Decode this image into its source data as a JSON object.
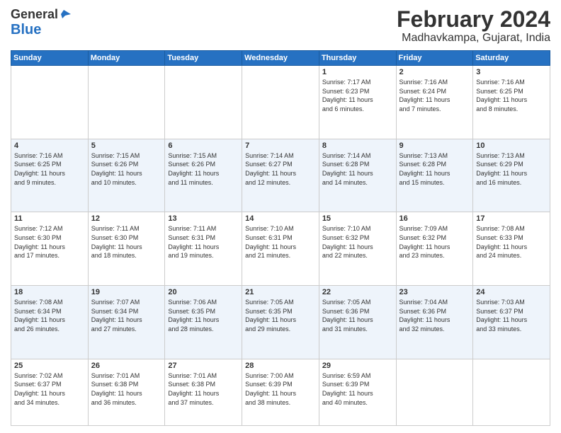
{
  "header": {
    "logo_line1": "General",
    "logo_line2": "Blue",
    "title": "February 2024",
    "subtitle": "Madhavkampa, Gujarat, India"
  },
  "days_of_week": [
    "Sunday",
    "Monday",
    "Tuesday",
    "Wednesday",
    "Thursday",
    "Friday",
    "Saturday"
  ],
  "weeks": [
    [
      {
        "day": "",
        "info": ""
      },
      {
        "day": "",
        "info": ""
      },
      {
        "day": "",
        "info": ""
      },
      {
        "day": "",
        "info": ""
      },
      {
        "day": "1",
        "info": "Sunrise: 7:17 AM\nSunset: 6:23 PM\nDaylight: 11 hours\nand 6 minutes."
      },
      {
        "day": "2",
        "info": "Sunrise: 7:16 AM\nSunset: 6:24 PM\nDaylight: 11 hours\nand 7 minutes."
      },
      {
        "day": "3",
        "info": "Sunrise: 7:16 AM\nSunset: 6:25 PM\nDaylight: 11 hours\nand 8 minutes."
      }
    ],
    [
      {
        "day": "4",
        "info": "Sunrise: 7:16 AM\nSunset: 6:25 PM\nDaylight: 11 hours\nand 9 minutes."
      },
      {
        "day": "5",
        "info": "Sunrise: 7:15 AM\nSunset: 6:26 PM\nDaylight: 11 hours\nand 10 minutes."
      },
      {
        "day": "6",
        "info": "Sunrise: 7:15 AM\nSunset: 6:26 PM\nDaylight: 11 hours\nand 11 minutes."
      },
      {
        "day": "7",
        "info": "Sunrise: 7:14 AM\nSunset: 6:27 PM\nDaylight: 11 hours\nand 12 minutes."
      },
      {
        "day": "8",
        "info": "Sunrise: 7:14 AM\nSunset: 6:28 PM\nDaylight: 11 hours\nand 14 minutes."
      },
      {
        "day": "9",
        "info": "Sunrise: 7:13 AM\nSunset: 6:28 PM\nDaylight: 11 hours\nand 15 minutes."
      },
      {
        "day": "10",
        "info": "Sunrise: 7:13 AM\nSunset: 6:29 PM\nDaylight: 11 hours\nand 16 minutes."
      }
    ],
    [
      {
        "day": "11",
        "info": "Sunrise: 7:12 AM\nSunset: 6:30 PM\nDaylight: 11 hours\nand 17 minutes."
      },
      {
        "day": "12",
        "info": "Sunrise: 7:11 AM\nSunset: 6:30 PM\nDaylight: 11 hours\nand 18 minutes."
      },
      {
        "day": "13",
        "info": "Sunrise: 7:11 AM\nSunset: 6:31 PM\nDaylight: 11 hours\nand 19 minutes."
      },
      {
        "day": "14",
        "info": "Sunrise: 7:10 AM\nSunset: 6:31 PM\nDaylight: 11 hours\nand 21 minutes."
      },
      {
        "day": "15",
        "info": "Sunrise: 7:10 AM\nSunset: 6:32 PM\nDaylight: 11 hours\nand 22 minutes."
      },
      {
        "day": "16",
        "info": "Sunrise: 7:09 AM\nSunset: 6:32 PM\nDaylight: 11 hours\nand 23 minutes."
      },
      {
        "day": "17",
        "info": "Sunrise: 7:08 AM\nSunset: 6:33 PM\nDaylight: 11 hours\nand 24 minutes."
      }
    ],
    [
      {
        "day": "18",
        "info": "Sunrise: 7:08 AM\nSunset: 6:34 PM\nDaylight: 11 hours\nand 26 minutes."
      },
      {
        "day": "19",
        "info": "Sunrise: 7:07 AM\nSunset: 6:34 PM\nDaylight: 11 hours\nand 27 minutes."
      },
      {
        "day": "20",
        "info": "Sunrise: 7:06 AM\nSunset: 6:35 PM\nDaylight: 11 hours\nand 28 minutes."
      },
      {
        "day": "21",
        "info": "Sunrise: 7:05 AM\nSunset: 6:35 PM\nDaylight: 11 hours\nand 29 minutes."
      },
      {
        "day": "22",
        "info": "Sunrise: 7:05 AM\nSunset: 6:36 PM\nDaylight: 11 hours\nand 31 minutes."
      },
      {
        "day": "23",
        "info": "Sunrise: 7:04 AM\nSunset: 6:36 PM\nDaylight: 11 hours\nand 32 minutes."
      },
      {
        "day": "24",
        "info": "Sunrise: 7:03 AM\nSunset: 6:37 PM\nDaylight: 11 hours\nand 33 minutes."
      }
    ],
    [
      {
        "day": "25",
        "info": "Sunrise: 7:02 AM\nSunset: 6:37 PM\nDaylight: 11 hours\nand 34 minutes."
      },
      {
        "day": "26",
        "info": "Sunrise: 7:01 AM\nSunset: 6:38 PM\nDaylight: 11 hours\nand 36 minutes."
      },
      {
        "day": "27",
        "info": "Sunrise: 7:01 AM\nSunset: 6:38 PM\nDaylight: 11 hours\nand 37 minutes."
      },
      {
        "day": "28",
        "info": "Sunrise: 7:00 AM\nSunset: 6:39 PM\nDaylight: 11 hours\nand 38 minutes."
      },
      {
        "day": "29",
        "info": "Sunrise: 6:59 AM\nSunset: 6:39 PM\nDaylight: 11 hours\nand 40 minutes."
      },
      {
        "day": "",
        "info": ""
      },
      {
        "day": "",
        "info": ""
      }
    ]
  ]
}
